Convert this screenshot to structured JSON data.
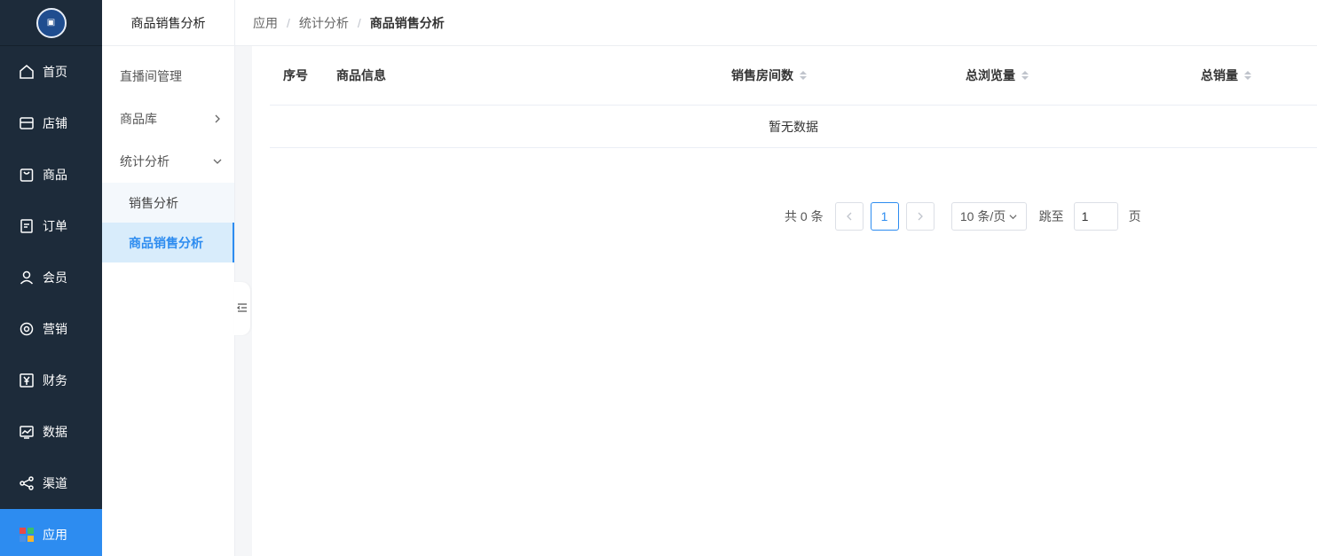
{
  "nav": {
    "items": [
      {
        "label": "首页",
        "icon": "home-icon",
        "active": false
      },
      {
        "label": "店铺",
        "icon": "store-icon",
        "active": false
      },
      {
        "label": "商品",
        "icon": "bag-icon",
        "active": false
      },
      {
        "label": "订单",
        "icon": "order-icon",
        "active": false
      },
      {
        "label": "会员",
        "icon": "user-icon",
        "active": false
      },
      {
        "label": "营销",
        "icon": "gear-icon",
        "active": false
      },
      {
        "label": "财务",
        "icon": "yen-icon",
        "active": false
      },
      {
        "label": "数据",
        "icon": "chart-icon",
        "active": false
      },
      {
        "label": "渠道",
        "icon": "share-icon",
        "active": false
      },
      {
        "label": "应用",
        "icon": "apps-icon",
        "active": true
      }
    ]
  },
  "submenu": {
    "title": "商品销售分析",
    "items": [
      {
        "label": "直播间管理"
      },
      {
        "label": "商品库"
      },
      {
        "label": "统计分析"
      }
    ],
    "children": [
      {
        "label": "销售分析",
        "active": false
      },
      {
        "label": "商品销售分析",
        "active": true
      }
    ]
  },
  "breadcrumb": [
    "应用",
    "统计分析",
    "商品销售分析"
  ],
  "table": {
    "columns": [
      "序号",
      "商品信息",
      "销售房间数",
      "总浏览量",
      "总销量"
    ],
    "empty_text": "暂无数据"
  },
  "pagination": {
    "total_text": "共 0 条",
    "current_page": "1",
    "page_size": "10 条/页",
    "jump_label": "跳至",
    "jump_value": "1",
    "page_suffix": "页"
  },
  "colors": {
    "nav_bg": "#1d2b3a",
    "accent": "#2d8cf0",
    "submenu_active_bg": "#d8ecfb"
  }
}
